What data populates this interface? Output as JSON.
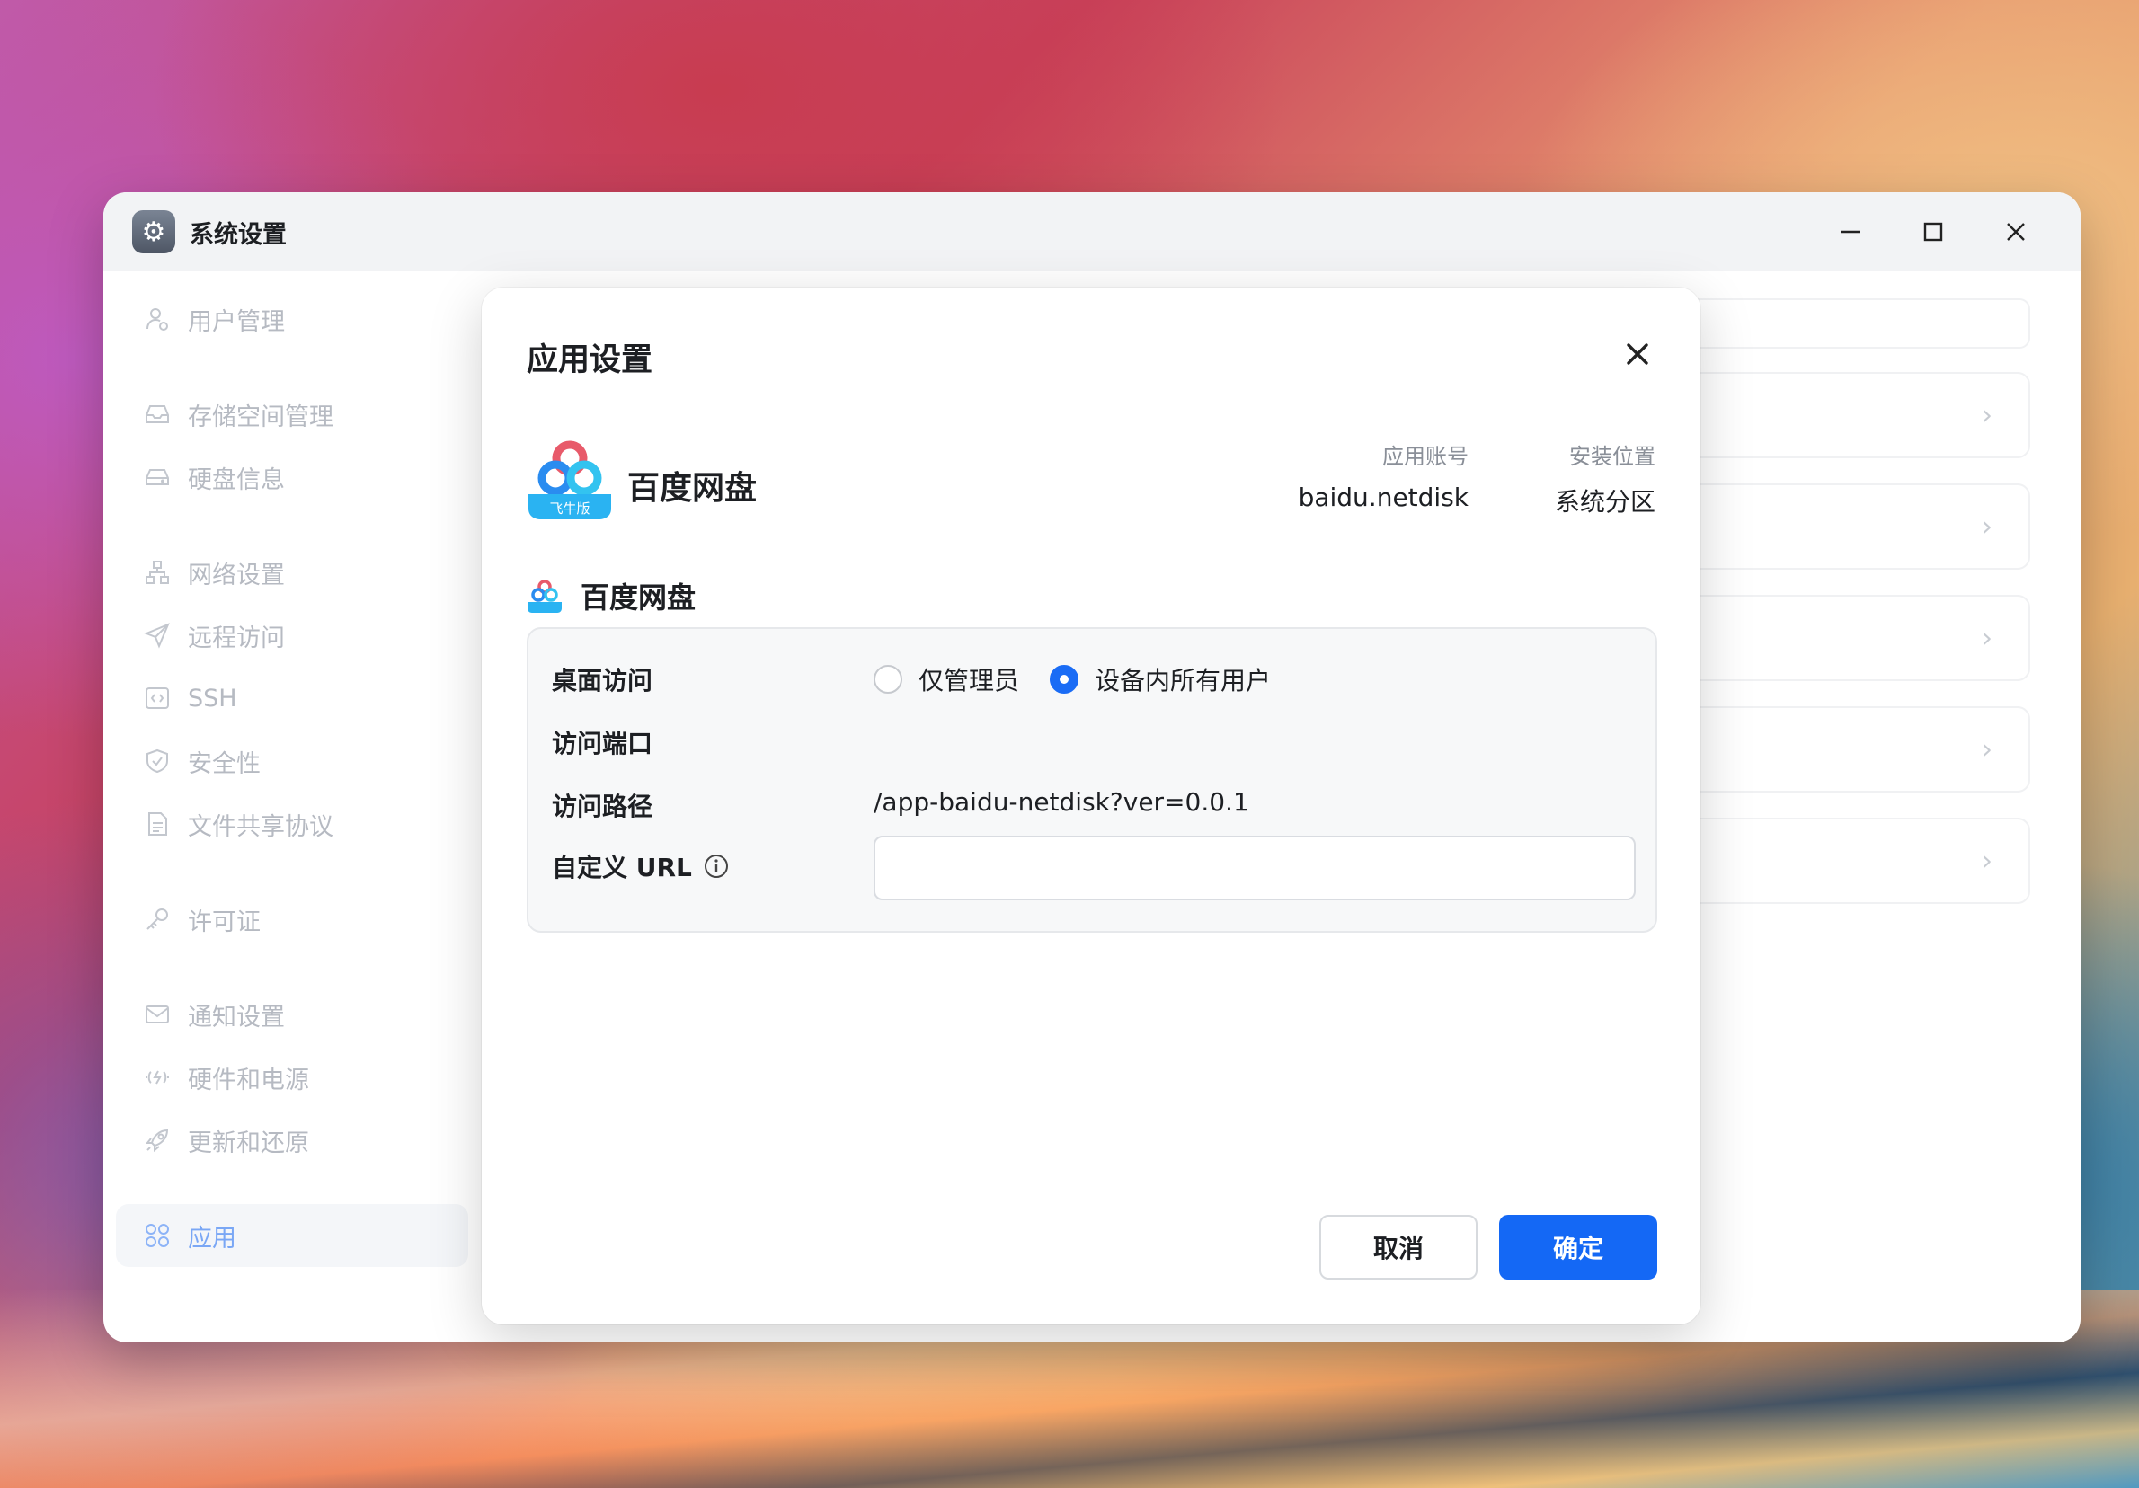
{
  "window": {
    "title": "系统设置",
    "icon": "gear-icon"
  },
  "sidebar": {
    "items": [
      {
        "label": "用户管理",
        "icon": "user-icon"
      },
      {
        "label": "存储空间管理",
        "icon": "storage-icon"
      },
      {
        "label": "硬盘信息",
        "icon": "disk-icon"
      },
      {
        "label": "网络设置",
        "icon": "network-icon"
      },
      {
        "label": "远程访问",
        "icon": "send-icon"
      },
      {
        "label": "SSH",
        "icon": "code-icon"
      },
      {
        "label": "安全性",
        "icon": "shield-icon"
      },
      {
        "label": "文件共享协议",
        "icon": "file-icon"
      },
      {
        "label": "许可证",
        "icon": "key-icon"
      },
      {
        "label": "通知设置",
        "icon": "mail-icon"
      },
      {
        "label": "硬件和电源",
        "icon": "power-icon"
      },
      {
        "label": "更新和还原",
        "icon": "rocket-icon"
      },
      {
        "label": "应用",
        "icon": "apps-icon"
      }
    ]
  },
  "dialog": {
    "title": "应用设置",
    "app_name": "百度网盘",
    "logo_badge": "飞牛版",
    "account_label": "应用账号",
    "account_value": "baidu.netdisk",
    "location_label": "安装位置",
    "location_value": "系统分区",
    "section_title": "百度网盘",
    "desktop_access_label": "桌面访问",
    "radio_admin_only": "仅管理员",
    "radio_all_users": "设备内所有用户",
    "selected_radio": "radio_all_users",
    "port_label": "访问端口",
    "path_label": "访问路径",
    "path_value": "/app-baidu-netdisk?ver=0.0.1",
    "custom_url_label": "自定义 URL",
    "custom_url_value": "",
    "cancel_label": "取消",
    "ok_label": "确定"
  },
  "colors": {
    "accent": "#1468f5",
    "sidebar_active_text": "#7aa7f5"
  }
}
